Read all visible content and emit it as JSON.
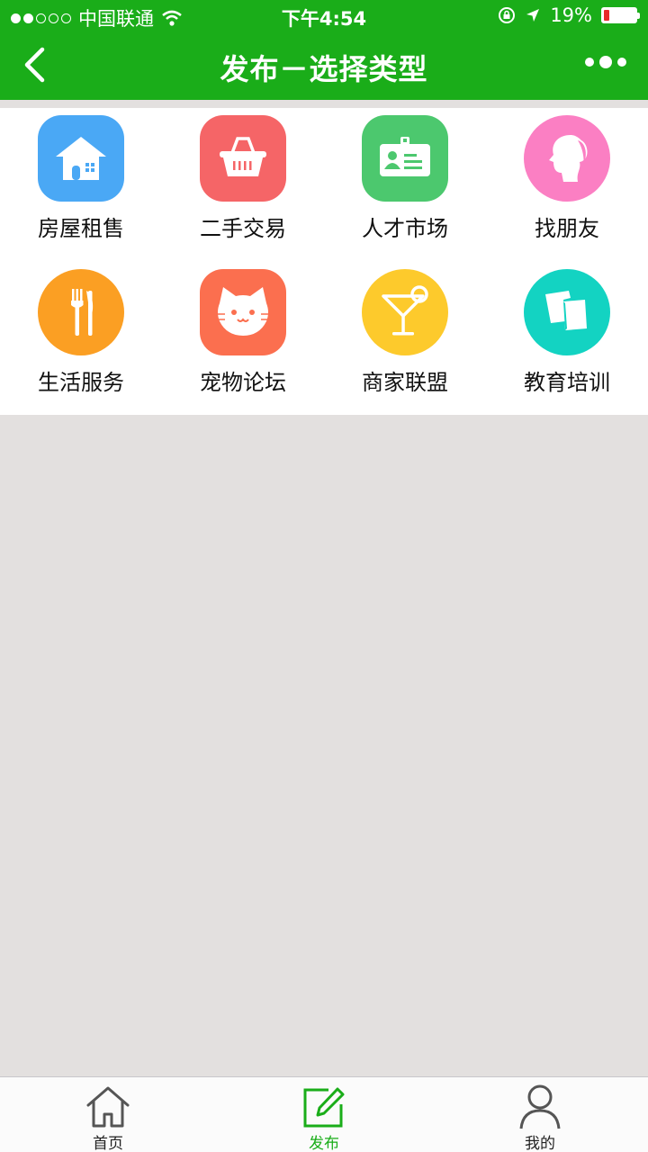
{
  "status_bar": {
    "carrier": "中国联通",
    "time": "下午4:54",
    "battery_percent": "19%",
    "battery_level": 0.19,
    "battery_color": "#e8292b"
  },
  "nav": {
    "title": "发布－选择类型",
    "back_icon": "chevron-left-icon",
    "more_icon": "more-dots-icon",
    "bg_color": "#1aad19"
  },
  "categories": [
    {
      "label": "房屋租售",
      "icon": "house-icon",
      "color": "#4aa8f5"
    },
    {
      "label": "二手交易",
      "icon": "basket-icon",
      "color": "#f56567"
    },
    {
      "label": "人才市场",
      "icon": "id-card-icon",
      "color": "#4cc86e"
    },
    {
      "label": "找朋友",
      "icon": "girl-profile-icon",
      "color": "#fb7fc3"
    },
    {
      "label": "生活服务",
      "icon": "fork-knife-icon",
      "color": "#fb9f23"
    },
    {
      "label": "宠物论坛",
      "icon": "cat-icon",
      "color": "#fb6f4f"
    },
    {
      "label": "商家联盟",
      "icon": "cocktail-icon",
      "color": "#fdca2c"
    },
    {
      "label": "教育培训",
      "icon": "cards-icon",
      "color": "#13d3c2"
    }
  ],
  "tabbar": {
    "items": [
      {
        "label": "首页",
        "icon": "home-icon",
        "active": false
      },
      {
        "label": "发布",
        "icon": "edit-icon",
        "active": true
      },
      {
        "label": "我的",
        "icon": "user-icon",
        "active": false
      }
    ],
    "active_color": "#1aad19"
  }
}
